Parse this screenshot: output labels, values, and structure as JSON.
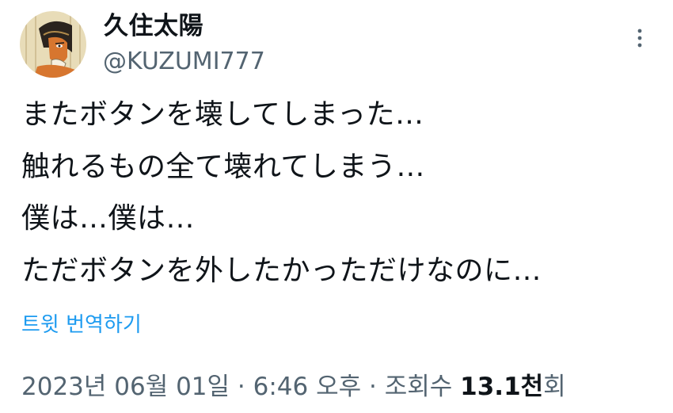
{
  "author": {
    "display_name": "久住太陽",
    "handle": "@KUZUMI777",
    "avatar_icon": "user-avatar"
  },
  "more_icon": "more-vertical-icon",
  "tweet": {
    "lines": [
      "またボタンを壊してしまった…",
      "触れるもの全て壊れてしまう…",
      "僕は…僕は…",
      "ただボタンを外したかっただけなのに…"
    ]
  },
  "translate_label": "트윗 번역하기",
  "meta": {
    "date": "2023년 06월 01일",
    "separator": "·",
    "time": "6:46 오후",
    "views_prefix": "조회수",
    "views_count": "13.1천",
    "views_suffix": "회"
  },
  "colors": {
    "text": "#0f1419",
    "secondary": "#536471",
    "link": "#1d9bf0"
  }
}
